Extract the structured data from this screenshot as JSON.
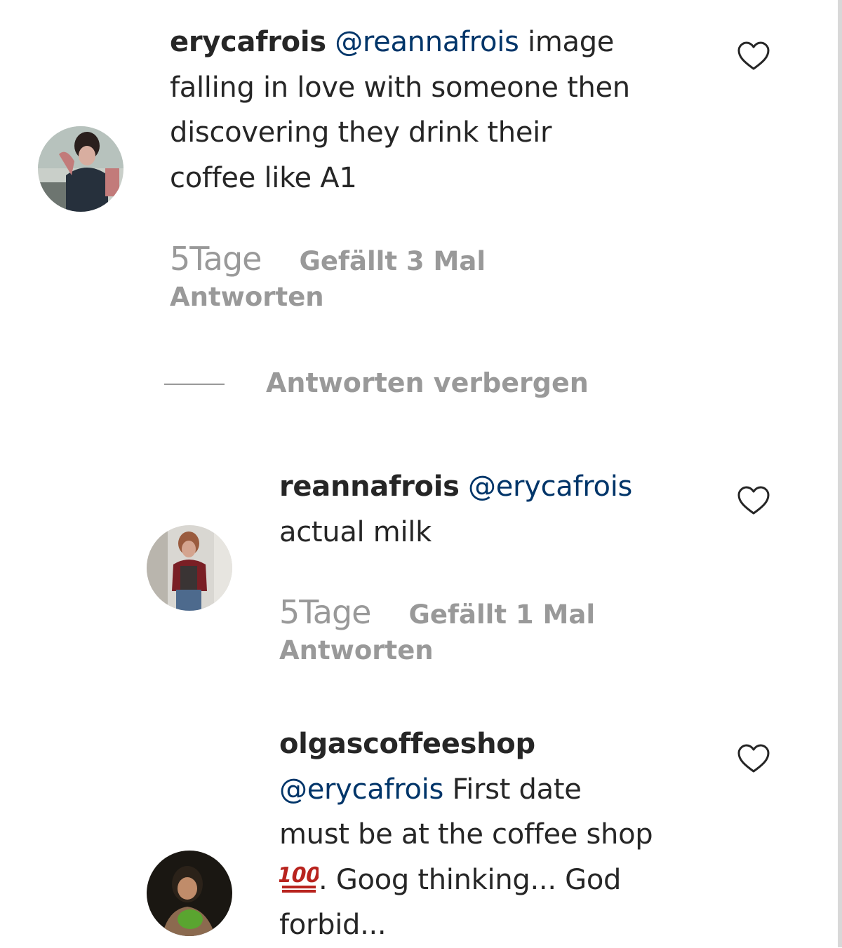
{
  "comments": [
    {
      "username": "erycafrois",
      "mention": "@reannafrois",
      "text_lines": [
        "image",
        "falling in love with someone then",
        "discovering they drink their",
        "coffee like A1"
      ],
      "time": "5Tage",
      "likes": "Gefällt 3 Mal",
      "reply_label": "Antworten"
    }
  ],
  "hide_replies_label": "Antworten verbergen",
  "replies": [
    {
      "username": "reannafrois",
      "mention": "@erycafrois",
      "text_lines": [
        "actual milk"
      ],
      "time": "5Tage",
      "likes": "Gefällt 1 Mal",
      "reply_label": "Antworten"
    },
    {
      "username": "olgascoffeeshop",
      "mention": "@erycafrois",
      "text_lines": [
        "First date",
        "must be at the coffee shop",
        ". Goog thinking... God",
        "forbid..."
      ],
      "emoji": "hundred-points-emoji"
    }
  ],
  "colors": {
    "text": "#262626",
    "mention": "#003569",
    "meta": "#999999"
  },
  "icons": [
    "heart-icon",
    "hundred-points-emoji"
  ]
}
